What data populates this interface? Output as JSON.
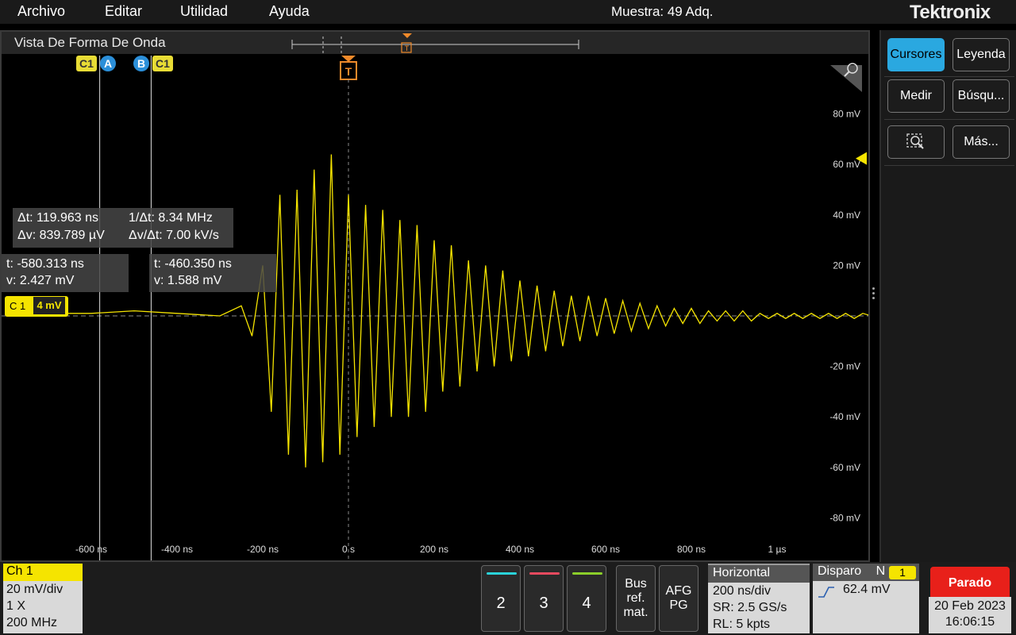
{
  "menu": {
    "items": [
      "Archivo",
      "Editar",
      "Utilidad",
      "Ayuda"
    ],
    "acquisition_status": "Muestra: 49 Adq.",
    "brand": "Tektronix"
  },
  "waveform_view": {
    "title": "Vista De Forma De Onda",
    "trigger_marker": "T",
    "cursor_tags": {
      "c1_left": "C1",
      "a": "A",
      "b": "B",
      "c1_right": "C1"
    },
    "channel_tag": {
      "label": "C 1",
      "scale": "4 mV"
    },
    "delta_readout": {
      "dt": "Δt: 119.963 ns",
      "inv_dt": "1/Δt: 8.34 MHz",
      "dv": "Δv: 839.789 µV",
      "dv_dt": "Δv/Δt: 7.00 kV/s"
    },
    "cursor_a_readout": {
      "t": "t: -580.313 ns",
      "v": "v: 2.427 mV"
    },
    "cursor_b_readout": {
      "t": "t: -460.350 ns",
      "v": "v: 1.588 mV"
    }
  },
  "chart_data": {
    "type": "line",
    "x_tick_labels": [
      "-600 ns",
      "-400 ns",
      "-200 ns",
      "0 s",
      "200 ns",
      "400 ns",
      "600 ns",
      "800 ns",
      "1 µs"
    ],
    "x_ticks": [
      -600,
      -400,
      -200,
      0,
      200,
      400,
      600,
      800,
      1000
    ],
    "y_tick_labels": [
      "80 mV",
      "60 mV",
      "40 mV",
      "20 mV",
      "-20 mV",
      "-40 mV",
      "-60 mV",
      "-80 mV"
    ],
    "y_ticks": [
      80,
      60,
      40,
      20,
      -20,
      -40,
      -60,
      -80
    ],
    "xlim": [
      -660,
      1220
    ],
    "ylim": [
      -100,
      100
    ],
    "x_unit": "ns",
    "y_unit": "mV",
    "grid": false,
    "series": [
      {
        "color": "#f5e400",
        "x": [
          -660,
          -600,
          -500,
          -400,
          -300,
          -250,
          -225,
          -200,
          -180,
          -160,
          -140,
          -120,
          -100,
          -80,
          -60,
          -40,
          -20,
          0,
          20,
          40,
          60,
          80,
          100,
          120,
          140,
          160,
          180,
          200,
          220,
          240,
          260,
          280,
          300,
          320,
          340,
          360,
          380,
          400,
          420,
          440,
          460,
          480,
          500,
          520,
          540,
          560,
          580,
          600,
          620,
          640,
          660,
          680,
          700,
          720,
          740,
          760,
          780,
          800,
          820,
          840,
          860,
          880,
          900,
          920,
          940,
          960,
          980,
          1000,
          1020,
          1040,
          1060,
          1080,
          1100,
          1120,
          1140,
          1160,
          1180,
          1200,
          1220
        ],
        "y": [
          1,
          1,
          2,
          1,
          0,
          4,
          -8,
          20,
          -38,
          48,
          -55,
          50,
          -60,
          58,
          -58,
          64,
          -55,
          48,
          -48,
          44,
          -44,
          42,
          -40,
          38,
          -40,
          36,
          -38,
          30,
          -30,
          28,
          -28,
          22,
          -22,
          20,
          -20,
          18,
          -18,
          14,
          -16,
          12,
          -14,
          10,
          -12,
          8,
          -10,
          8,
          -8,
          7,
          -7,
          6,
          -6,
          5,
          -5,
          4,
          -4,
          3,
          -3,
          3,
          -3,
          2,
          -2,
          2,
          -2,
          2,
          -2,
          1,
          -1,
          1,
          -1,
          1,
          -1,
          1,
          -1,
          1,
          -1,
          1,
          -1,
          1,
          0
        ]
      }
    ],
    "cursors_x": [
      -580.313,
      -460.35
    ],
    "trigger_level_mv": 62.4
  },
  "side_panel": {
    "buttons": [
      "Cursores",
      "Leyenda",
      "Medir",
      "Búsqu...",
      "Más..."
    ],
    "zoom_icon": "zoom-box-icon"
  },
  "bottom": {
    "ch1": {
      "title": "Ch 1",
      "scale": "20 mV/div",
      "probe": "1 X",
      "bandwidth": "200 MHz"
    },
    "channels": [
      {
        "label": "2",
        "color": "#2ad3d9"
      },
      {
        "label": "3",
        "color": "#e84a5f"
      },
      {
        "label": "4",
        "color": "#8ccf2a"
      }
    ],
    "bus_label": "Bus ref. mat.",
    "afg_label": "AFG PG",
    "horizontal": {
      "title": "Horizontal",
      "scale": "200 ns/div",
      "sample_rate": "SR: 2.5 GS/s",
      "record_length": "RL: 5 kpts"
    },
    "trigger": {
      "title": "Disparo",
      "mode": "N",
      "source": "1",
      "level": "62.4 mV"
    },
    "run_state": "Parado",
    "date": "20 Feb 2023",
    "time": "16:06:15"
  }
}
